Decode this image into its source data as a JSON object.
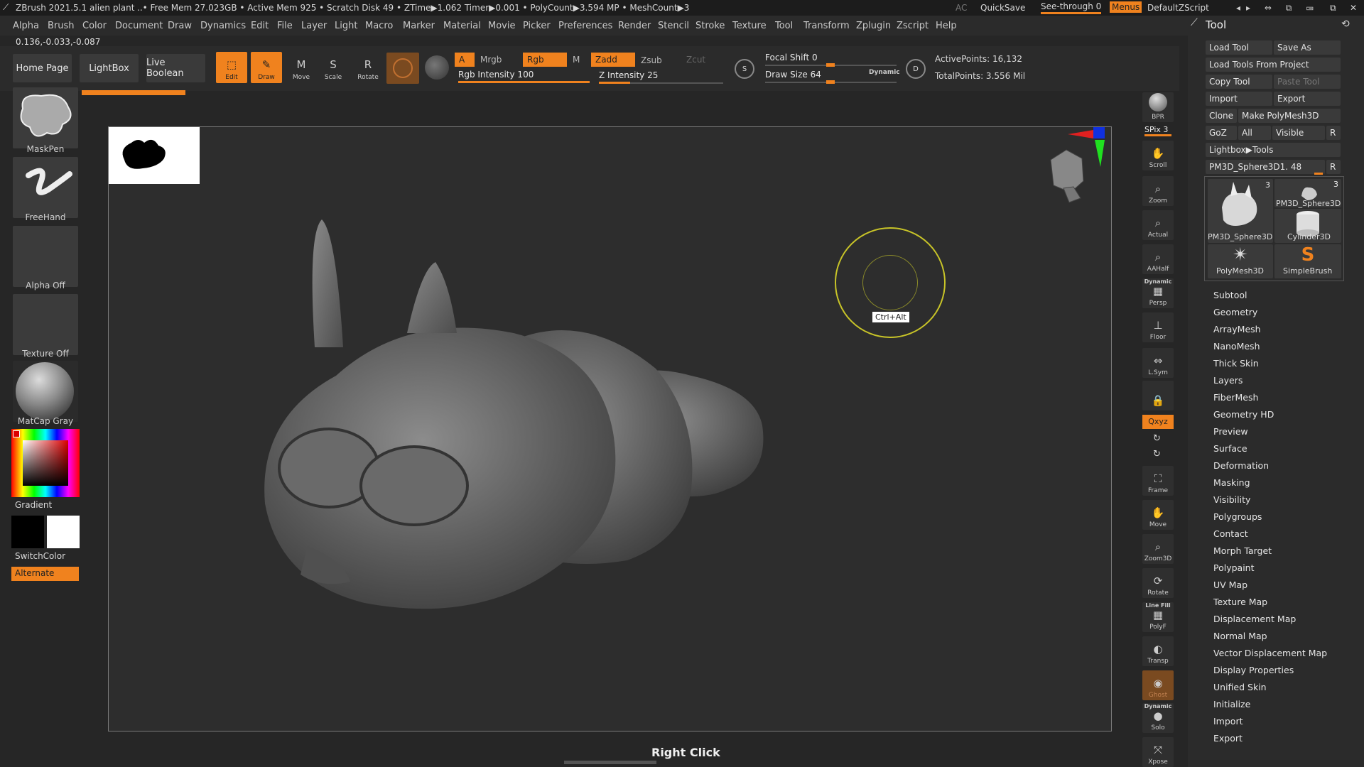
{
  "titlebar": {
    "app": "ZBrush 2021.5.1",
    "doc": "alien plant",
    "stats": "..• Free Mem 27.023GB • Active Mem 925 • Scratch Disk 49 •  ZTime▶1.062 Timer▶0.001 • PolyCount▶3.594 MP  • MeshCount▶3",
    "ac": "AC",
    "quicksave": "QuickSave",
    "seethrough": "See-through   0",
    "menus": "Menus",
    "script": "DefaultZScript"
  },
  "menubar": [
    "Alpha",
    "Brush",
    "Color",
    "Document",
    "Draw",
    "Dynamics",
    "Edit",
    "File",
    "Layer",
    "Light",
    "Macro",
    "Marker",
    "Material",
    "Movie",
    "Picker",
    "Preferences",
    "Render",
    "Stencil",
    "Stroke",
    "Texture",
    "Tool",
    "Transform",
    "Zplugin",
    "Zscript",
    "Help"
  ],
  "coords": "0.136,-0.033,-0.087",
  "shelf": {
    "home": "Home Page",
    "lightbox": "LightBox",
    "liveboolean": "Live Boolean",
    "edit": "Edit",
    "draw": "Draw",
    "move": "Move",
    "scale": "Scale",
    "rotate": "Rotate",
    "a": "A",
    "mrgb": "Mrgb",
    "rgb": "Rgb",
    "m": "M",
    "zadd": "Zadd",
    "zsub": "Zsub",
    "zcut": "Zcut",
    "rgb_intensity": "Rgb Intensity 100",
    "z_intensity": "Z Intensity 25",
    "focal_shift": "Focal Shift 0",
    "draw_size": "Draw Size 64",
    "dynamic": "Dynamic",
    "active_points": "ActivePoints: 16,132",
    "total_points": "TotalPoints: 3.556 Mil",
    "rgb_intensity_value": 100,
    "z_intensity_value": 25,
    "focal_shift_value": 0,
    "draw_size_value": 64
  },
  "lefttray": {
    "maskpen": "MaskPen",
    "freehand": "FreeHand",
    "alpha": "Alpha Off",
    "texture": "Texture Off",
    "matcap": "MatCap Gray",
    "gradient": "Gradient",
    "switchcolor": "SwitchColor",
    "alternate": "Alternate"
  },
  "canvas": {
    "tooltip": "Ctrl+Alt",
    "right_click": "Right Click"
  },
  "righttoolbar": {
    "bpr": "BPR",
    "spix": "SPix 3",
    "scroll": "Scroll",
    "zoom": "Zoom",
    "actual": "Actual",
    "aahalf": "AAHalf",
    "dynamic": "Dynamic",
    "persp": "Persp",
    "floor": "Floor",
    "lsym": "L.Sym",
    "xyz": "Qxyz",
    "frame": "Frame",
    "move": "Move",
    "zoom3d": "Zoom3D",
    "rotate": "Rotate",
    "linefill": "Line Fill",
    "polyf": "PolyF",
    "transp": "Transp",
    "ghost": "Ghost",
    "dynamic2": "Dynamic",
    "solo": "Solo",
    "xpose": "Xpose"
  },
  "toolpanel": {
    "title": "Tool",
    "load_tool": "Load Tool",
    "save_as": "Save As",
    "load_from_project": "Load Tools From Project",
    "copy_tool": "Copy Tool",
    "paste_tool": "Paste Tool",
    "import": "Import",
    "export": "Export",
    "clone": "Clone",
    "make_polymesh": "Make PolyMesh3D",
    "goz": "GoZ",
    "all": "All",
    "visible": "Visible",
    "r": "R",
    "lightbox_tools": "Lightbox▶Tools",
    "current_tool": "PM3D_Sphere3D1. 48",
    "thumbs": [
      {
        "label": "PM3D_Sphere3D",
        "count": "3"
      },
      {
        "label": "PM3D_Sphere3D",
        "count": "3"
      },
      {
        "label": "Cylinder3D",
        "count": ""
      },
      {
        "label": "PolyMesh3D",
        "count": ""
      },
      {
        "label": "SimpleBrush",
        "count": ""
      }
    ],
    "sections": [
      "Subtool",
      "Geometry",
      "ArrayMesh",
      "NanoMesh",
      "Thick Skin",
      "Layers",
      "FiberMesh",
      "Geometry HD",
      "Preview",
      "Surface",
      "Deformation",
      "Masking",
      "Visibility",
      "Polygroups",
      "Contact",
      "Morph Target",
      "Polypaint",
      "UV Map",
      "Texture Map",
      "Displacement Map",
      "Normal Map",
      "Vector Displacement Map",
      "Display Properties",
      "Unified Skin",
      "Initialize",
      "Import",
      "Export"
    ]
  },
  "colors": {
    "accent": "#f0821e",
    "panel": "#2b2b2b",
    "canvas": "#2d2d2d"
  }
}
